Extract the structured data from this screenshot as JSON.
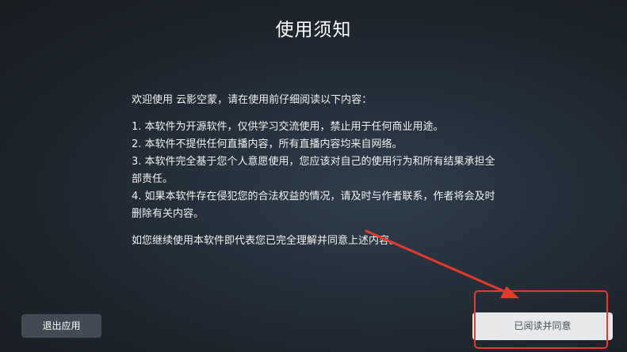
{
  "dialog": {
    "title": "使用须知",
    "intro": "欢迎使用 云影空蒙，请在使用前仔细阅读以下内容：",
    "items": [
      "1. 本软件为开源软件，仅供学习交流使用，禁止用于任何商业用途。",
      "2. 本软件不提供任何直播内容，所有直播内容均来自网络。",
      "3. 本软件完全基于您个人意愿使用，您应该对自己的使用行为和所有结果承担全部责任。",
      "4. 如果本软件存在侵犯您的合法权益的情况，请及时与作者联系，作者将会及时删除有关内容。"
    ],
    "closing": "如您继续使用本软件即代表您已完全理解并同意上述内容。"
  },
  "buttons": {
    "exit_label": "退出应用",
    "agree_label": "已阅读并同意"
  },
  "annotation": {
    "color": "#e83a2a"
  }
}
